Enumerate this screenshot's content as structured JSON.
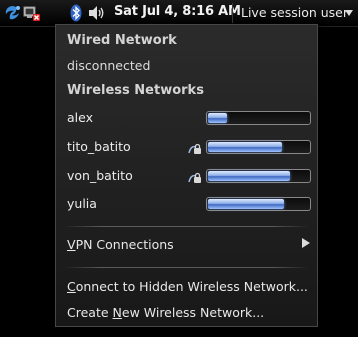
{
  "panel": {
    "clock": "Sat Jul  4,  8:16 AM",
    "user_label": "Live session user",
    "tray_icons": [
      "distro-logo-icon",
      "network-disconnected-icon",
      "bluetooth-icon",
      "volume-icon"
    ]
  },
  "menu": {
    "wired_header": "Wired Network",
    "wired_status": "disconnected",
    "wireless_header": "Wireless Networks",
    "networks": [
      {
        "name": "alex",
        "secured": false,
        "signal": 0.18
      },
      {
        "name": "tito_batito",
        "secured": true,
        "signal": 0.72
      },
      {
        "name": "von_batito",
        "secured": true,
        "signal": 0.8
      },
      {
        "name": "yulia",
        "secured": false,
        "signal": 0.74
      }
    ],
    "vpn": {
      "mnemonic": "V",
      "rest": "PN Connections"
    },
    "connect_hidden": {
      "before": "",
      "mnemonic": "C",
      "after": "onnect to Hidden Wireless Network..."
    },
    "create_new": {
      "before": "Create ",
      "mnemonic": "N",
      "after": "ew Wireless Network..."
    }
  },
  "colors": {
    "accent_bar": "#4a74c9",
    "menu_bg": "#222222"
  }
}
